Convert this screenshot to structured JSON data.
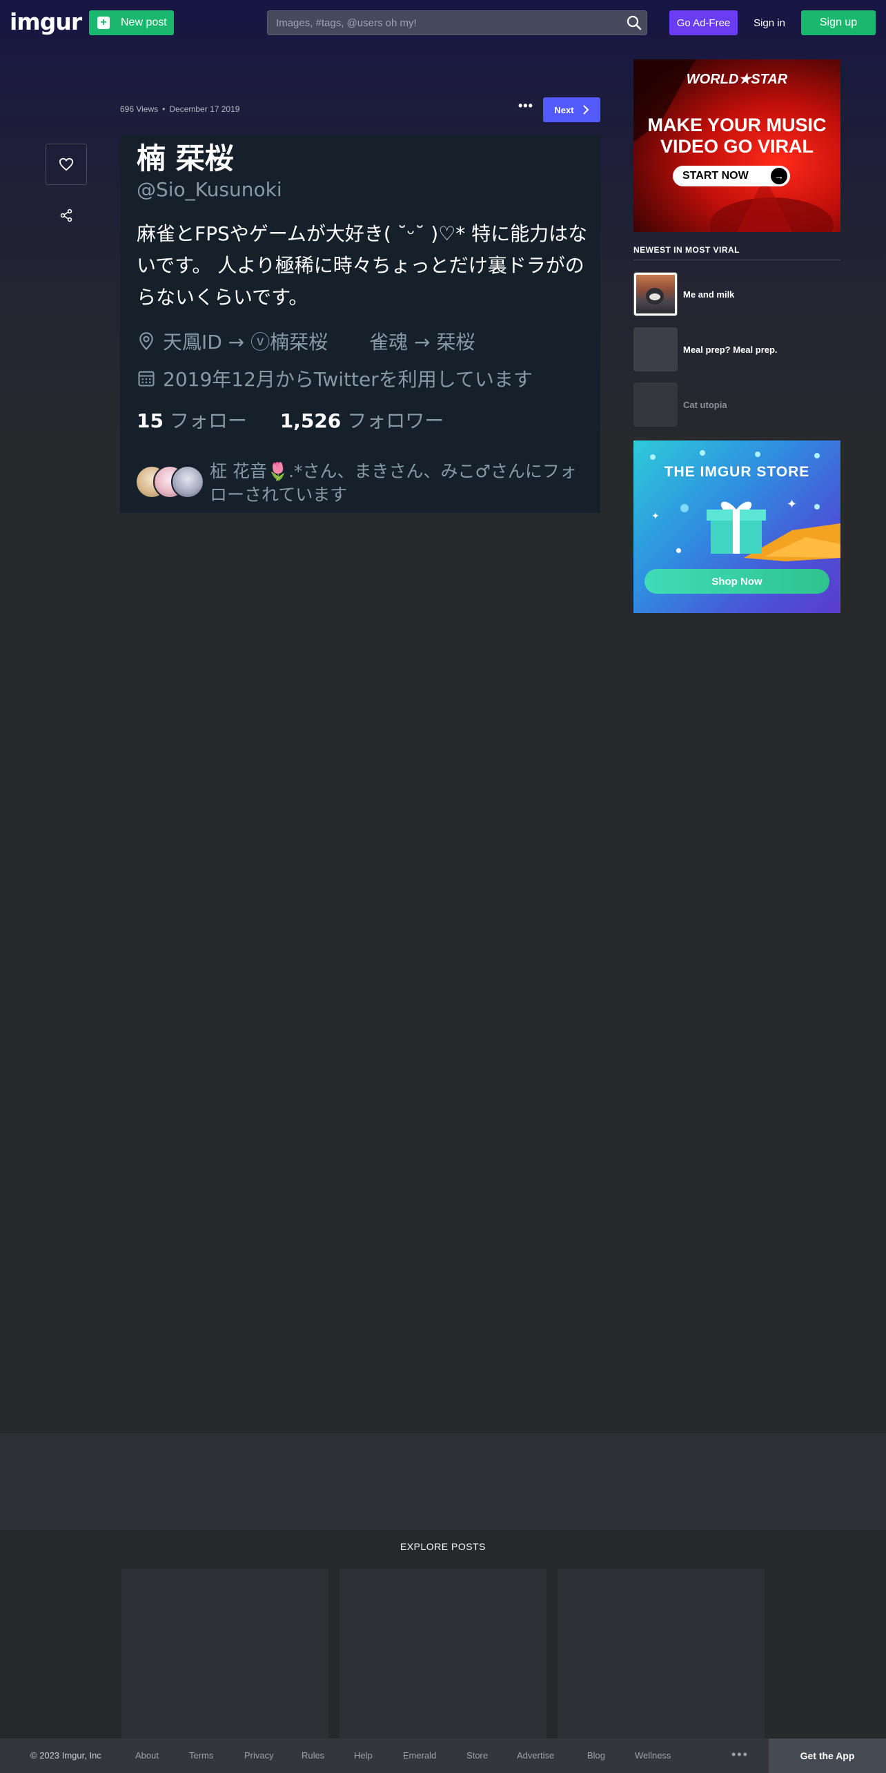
{
  "header": {
    "logo_text": "imgur",
    "new_post_label": "New post",
    "search_placeholder": "Images, #tags, @users oh my!",
    "go_adfree_label": "Go Ad-Free",
    "signin_label": "Sign in",
    "signup_label": "Sign up"
  },
  "post": {
    "views": "696 Views",
    "separator": "•",
    "date": "December 17 2019",
    "more_label": "•••",
    "next_label": "Next",
    "image": {
      "name": "楠 栞桜",
      "handle": "@Sio_Kusunoki",
      "bio": "麻雀とFPSやゲームが大好き( ˘ᵕ˘ )♡* 特に能力はないです。 人より極稀に時々ちょっとだけ裏ドラがのらないくらいです。",
      "location_a": "天鳳ID → ⓥ楠栞桜",
      "location_b": "雀魂 → 栞桜",
      "joined": "2019年12月からTwitterを利用しています",
      "following_count": "15",
      "following_label": "フォロー",
      "followers_count": "1,526",
      "followers_label": "フォロワー",
      "followed_by": "柾 花音🌷.*さん、まきさん、みこ♂さんにフォローされています"
    }
  },
  "sidebar": {
    "ad_top": {
      "logo": "WORLD★STAR",
      "headline_1": "MAKE YOUR MUSIC",
      "headline_2": "VIDEO GO VIRAL",
      "cta": "START NOW"
    },
    "newest_heading": "NEWEST IN MOST VIRAL",
    "viral_items": [
      {
        "title": "Me and milk"
      },
      {
        "title": "Meal prep? Meal prep."
      },
      {
        "title": "Cat utopia"
      }
    ],
    "ad_store": {
      "title": "THE IMGUR STORE",
      "cta": "Shop Now"
    }
  },
  "explore": {
    "title": "EXPLORE POSTS"
  },
  "footer": {
    "copyright": "© 2023 Imgur, Inc",
    "links": [
      "About",
      "Terms",
      "Privacy",
      "Rules",
      "Help",
      "Emerald",
      "Store",
      "Advertise",
      "Blog",
      "Wellness"
    ],
    "more": "•••",
    "get_app": "Get the App"
  },
  "colors": {
    "accent_green": "#1bb76e",
    "accent_purple": "#6a3cf2",
    "next_blue": "#535bfe",
    "page_bg": "#27292d"
  },
  "icons": [
    "plus-icon",
    "search-icon",
    "heart-icon",
    "share-icon",
    "chevron-right-icon",
    "location-pin-icon",
    "calendar-icon",
    "arrow-right-icon",
    "gift-icon"
  ]
}
